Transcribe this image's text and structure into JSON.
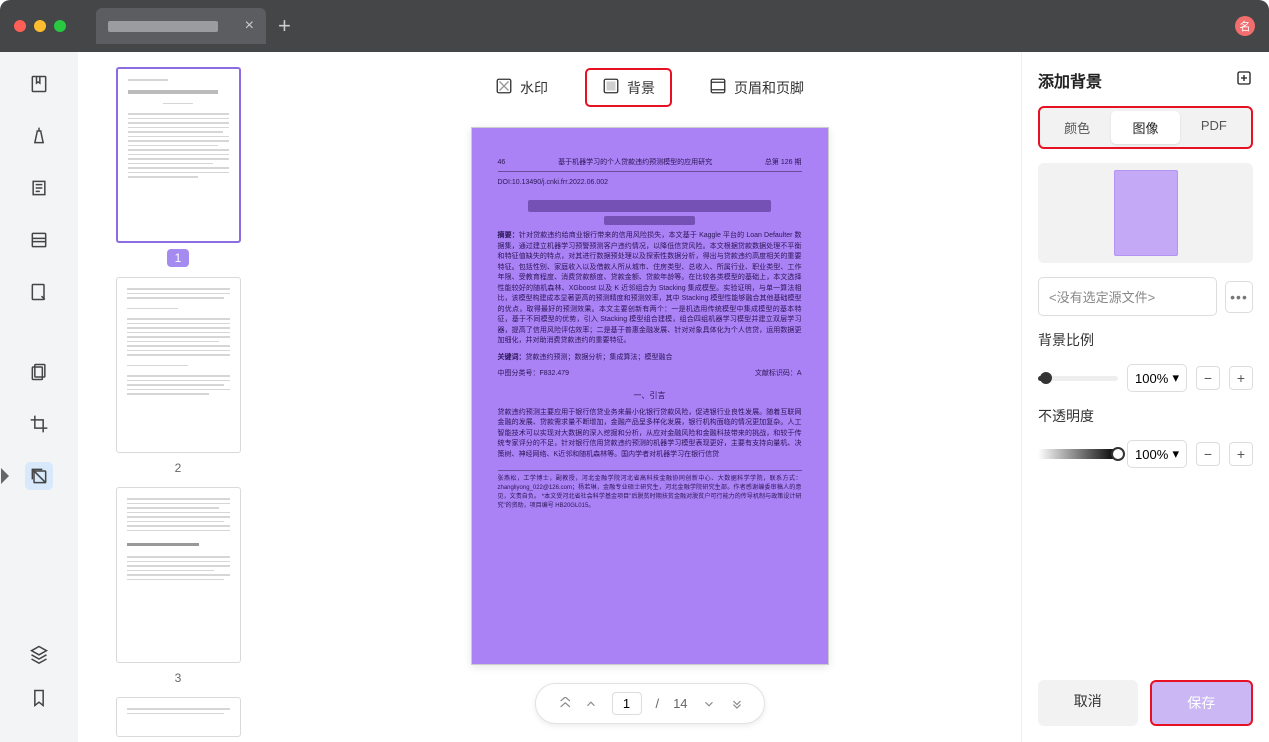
{
  "titlebar": {
    "avatar": "名"
  },
  "tabs": {
    "close": "×",
    "add": "+"
  },
  "topTabs": {
    "watermark": "水印",
    "background": "背景",
    "headerFooter": "页眉和页脚"
  },
  "thumbnails": [
    {
      "num": "1",
      "selected": true
    },
    {
      "num": "2",
      "selected": false
    },
    {
      "num": "3",
      "selected": false
    }
  ],
  "doc": {
    "pageNumLeft": "46",
    "headerTitle": "基于机器学习的个人贷款违约预测模型的应用研究",
    "headerRight": "总第 126 期",
    "doi": "DOI:10.13490/j.cnki.frr.2022.06.002",
    "abstractLabel": "摘要：",
    "abstract": "针对贷款违约给商业银行带来的信用风险损失，本文基于 Kaggle 平台的 Loan Defaulter 数据集，通过建立机器学习预警预测客户违约情况，以降低信贷风险。本文根据贷款数据处理不平衡和特征值缺失的特点，对其进行数据预处理以及探索性数据分析，得出与贷款违约高度相关的重要特征。包括性别、家庭收入以及借款人所从城市、住房类型、总收入、所属行业、职业类型、工作年限、受教育程度、消费贷款额度、贷款金额、贷款年龄等。在比较各类模型的基础上，本文选择性能较好的随机森林、XGboost 以及 K 近邻组合为 Stacking 集成模型。实验证明，与单一算法相比，该模型构建成本显著更高的预测精度和预测效率，其中 Stacking 模型性能够融合其他基础模型的优点，取得最好的预测效果。本文主要创新有两个：一是机选用传统模型中集成模型的基本特征，基于不同模型的优势，引入 Stacking 模型组合建模，组合四组机器学习模型并建立双层学习器，提高了信用风险评估效率；二是基于普惠金融发展、针对对象具体化为个人信贷，运用数据更加细化，并对助消费贷款违约的重要特征。",
    "keywordsLabel": "关键词：",
    "keywords": "贷款违约预测；数据分析；集成算法；模型融合",
    "classifyLeft": "中图分类号：F832.479",
    "classifyRight": "文献标识码：A",
    "sectionTitle": "一、引言",
    "introPara": "贷款违约预测主要应用于银行信贷业务来最小化银行贷款风险，促进银行业良性发展。随着互联网金融的发展、贷款需求量不断增加，金融产品呈多样化发展，银行机构面临的情况更加复杂。人工智能技术可以实现对大数据的深入挖掘和分析，从应对金融风险和金融科技带来的挑战，和较于传统专家评分的不足，针对银行信用贷款违约预测的机器学习模型表现更好，主要有支持向量机、决策树、神经网络、K近邻和随机森林等。国内学者对机器学习在银行信贷",
    "footnote": "张燕松，工学博士，副教授，河北金融学院河北省高科技金融协同创新中心、大数据科学学院，联系方式：zhangliyong_022@126.com；杨若琳，金融专业硕士研究生，河北金融学院研究生部。作者感谢编委审稿人的意见，文责自负。\n*本文受河北省社会科学基金项目\"后脱贫时期扶贫金融对脱贫户可行能力的传导机制与政策设计研究\"的资助，项目编号 HB20GL015。"
  },
  "pager": {
    "current": "1",
    "sep": "/",
    "total": "14"
  },
  "rightPanel": {
    "title": "添加背景",
    "seg": {
      "color": "颜色",
      "image": "图像",
      "pdf": "PDF"
    },
    "sourcePlaceholder": "<没有选定源文件>",
    "moreDots": "•••",
    "scaleLabel": "背景比例",
    "scaleValue": "100%",
    "opacityLabel": "不透明度",
    "opacityValue": "100%",
    "minus": "−",
    "plus": "+",
    "cancel": "取消",
    "save": "保存"
  }
}
